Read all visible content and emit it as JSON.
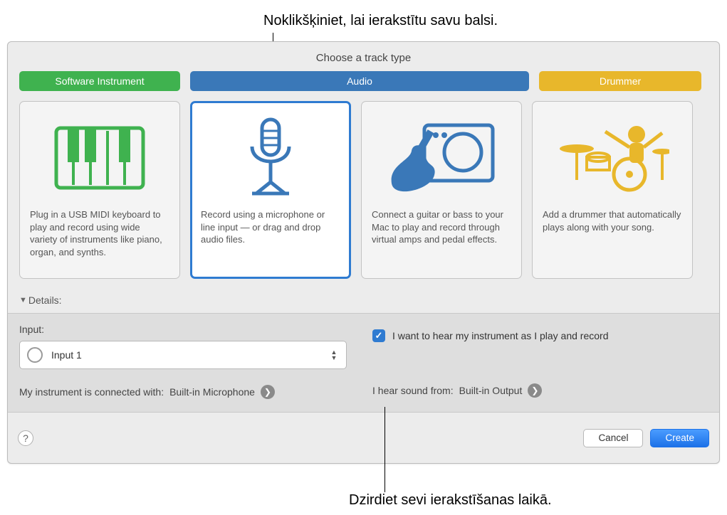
{
  "callouts": {
    "top": "Noklikšķiniet, lai ierakstītu savu balsi.",
    "bottom": "Dzirdiet sevi ierakstīšanas laikā."
  },
  "dialog": {
    "title": "Choose a track type",
    "tabs": {
      "software": "Software Instrument",
      "audio": "Audio",
      "drummer": "Drummer"
    },
    "cards": {
      "software": "Plug in a USB MIDI keyboard to play and record using wide variety of instruments like piano, organ, and synths.",
      "mic": "Record using a microphone or line input — or drag and drop audio files.",
      "guitar": "Connect a guitar or bass to your Mac to play and record through virtual amps and pedal effects.",
      "drummer": "Add a drummer that automatically plays along with your song."
    },
    "details_label": "Details:",
    "input_label": "Input:",
    "input_value": "Input 1",
    "monitor_label": "I want to hear my instrument as I play and record",
    "connected_label": "My instrument is connected with:",
    "connected_value": "Built-in Microphone",
    "output_label": "I hear sound from:",
    "output_value": "Built-in Output",
    "cancel": "Cancel",
    "create": "Create"
  }
}
